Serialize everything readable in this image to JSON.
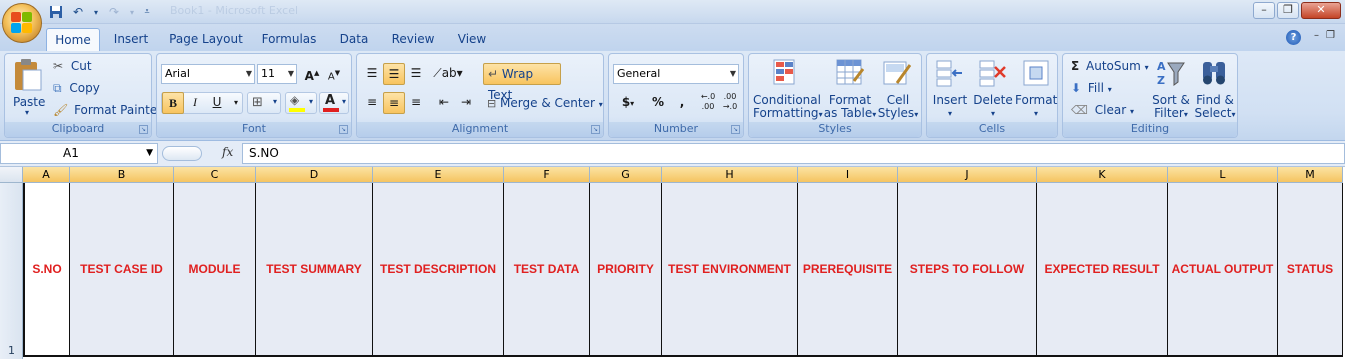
{
  "title_bar": {
    "document_title": "Book1 - Microsoft Excel",
    "window_controls": [
      "minimize",
      "restore",
      "close"
    ]
  },
  "tabs": [
    "Home",
    "Insert",
    "Page Layout",
    "Formulas",
    "Data",
    "Review",
    "View"
  ],
  "ribbon": {
    "clipboard": {
      "paste": "Paste",
      "cut": "Cut",
      "copy": "Copy",
      "format_painter": "Format Painter",
      "label": "Clipboard"
    },
    "font": {
      "family": "Arial",
      "size": "11",
      "label": "Font",
      "bold": "B",
      "italic": "I",
      "underline": "U"
    },
    "alignment": {
      "wrap_text": "Wrap Text",
      "merge_center": "Merge & Center",
      "label": "Alignment"
    },
    "number": {
      "format": "General",
      "currency": "$",
      "percent": "%",
      "comma": ",",
      "label": "Number"
    },
    "styles": {
      "conditional_formatting_1": "Conditional",
      "conditional_formatting_2": "Formatting",
      "format_table_1": "Format",
      "format_table_2": "as Table",
      "cell_styles_1": "Cell",
      "cell_styles_2": "Styles",
      "label": "Styles"
    },
    "cells": {
      "insert": "Insert",
      "delete": "Delete",
      "format": "Format",
      "label": "Cells"
    },
    "editing": {
      "autosum": "AutoSum",
      "fill": "Fill",
      "clear": "Clear",
      "sort_filter_1": "Sort &",
      "sort_filter_2": "Filter",
      "find_select_1": "Find &",
      "find_select_2": "Select",
      "label": "Editing"
    }
  },
  "formula_bar": {
    "name_box": "A1",
    "fx": "fx",
    "content": "S.NO"
  },
  "columns": [
    "A",
    "B",
    "C",
    "D",
    "E",
    "F",
    "G",
    "H",
    "I",
    "J",
    "K",
    "L",
    "M"
  ],
  "row_number": "1",
  "header_cells": [
    "S.NO",
    "TEST CASE ID",
    "MODULE",
    "TEST SUMMARY",
    "TEST DESCRIPTION",
    "TEST DATA",
    "PRIORITY",
    "TEST ENVIRONMENT",
    "PREREQUISITE",
    "STEPS TO FOLLOW",
    "EXPECTED RESULT",
    "ACTUAL OUTPUT",
    "STATUS"
  ],
  "colors": {
    "header_text": "#e02020",
    "cell_fill": "#e7ebf4",
    "ribbon": "#dbe7f6",
    "selected_header": "#f8c45f"
  }
}
